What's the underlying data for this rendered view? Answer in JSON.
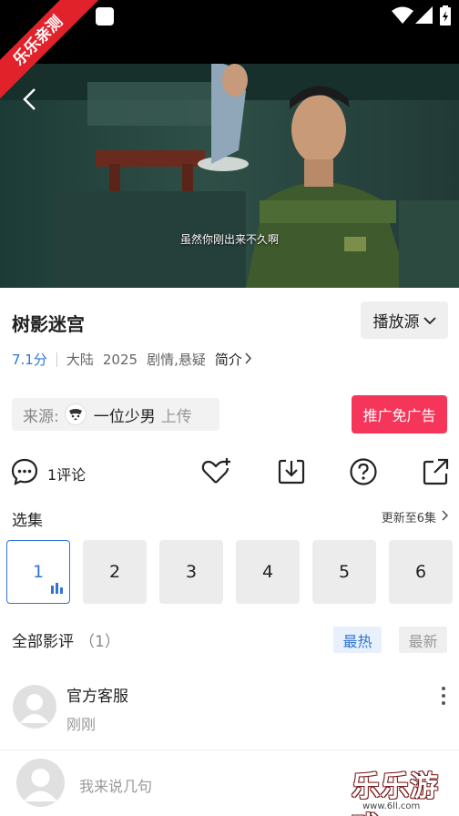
{
  "badge": {
    "text": "乐乐亲测"
  },
  "video": {
    "subtitle": "虽然你刚出来不久啊"
  },
  "movie": {
    "title": "树影迷宫",
    "score": "7.1分",
    "region": "大陆",
    "year": "2025",
    "genre": "剧情,悬疑",
    "intro_label": "简介"
  },
  "toolbar": {
    "source_label": "播放源"
  },
  "uploader": {
    "label": "来源:",
    "name": "一位少男",
    "action": "上传"
  },
  "promo": {
    "label": "推广免广告"
  },
  "actions": {
    "comment_count": "1评论"
  },
  "episodes": {
    "header": "选集",
    "update_text": "更新至6集",
    "items": [
      "1",
      "2",
      "3",
      "4",
      "5",
      "6"
    ],
    "active_index": 0
  },
  "reviews": {
    "title": "全部影评",
    "count": "（1）",
    "sort_hot": "最热",
    "sort_new": "最新",
    "items": [
      {
        "author": "官方客服",
        "time": "刚刚"
      }
    ]
  },
  "composer": {
    "placeholder": "我来说几句"
  },
  "watermark": {
    "text": "乐乐游戏",
    "url": "www.6ll.com"
  },
  "colors": {
    "accent": "#2f74d6",
    "promo": "#f5355a",
    "badge": "#e1222b"
  }
}
